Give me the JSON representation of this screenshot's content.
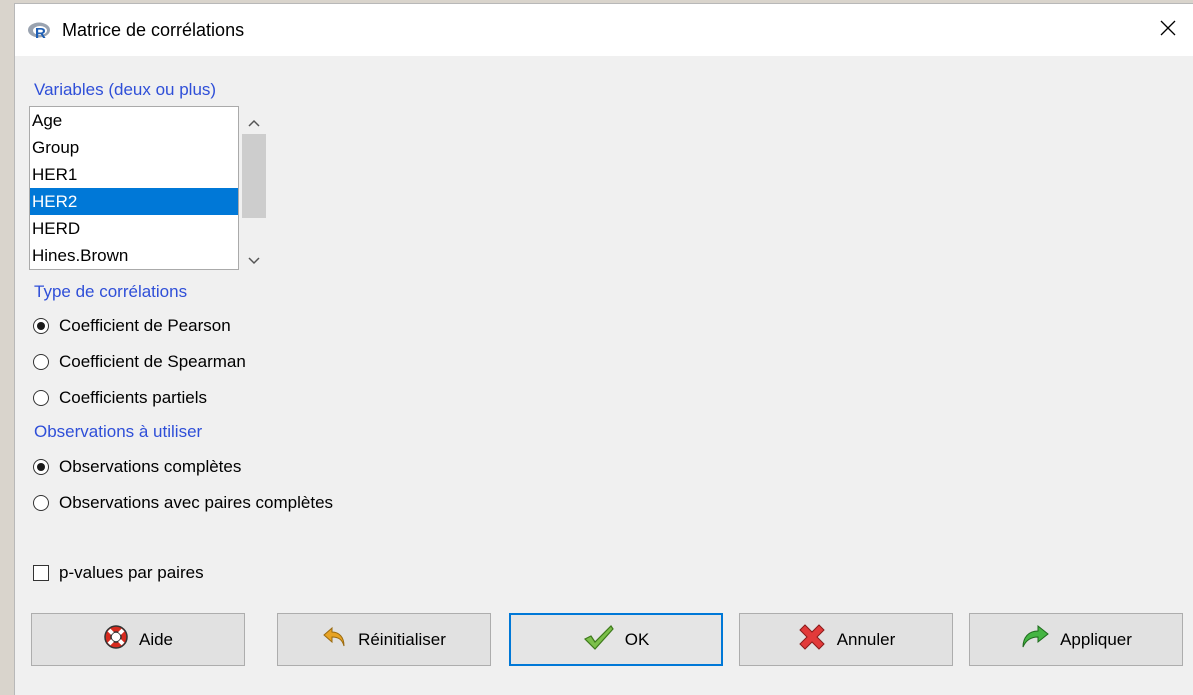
{
  "window": {
    "title": "Matrice de corrélations",
    "app_icon": "r-logo-icon",
    "close_icon": "close-icon"
  },
  "variables": {
    "label": "Variables (deux ou plus)",
    "items": [
      "Age",
      "Group",
      "HER1",
      "HER2",
      "HERD",
      "Hines.Brown"
    ],
    "selected": "HER2"
  },
  "correlation_type": {
    "label": "Type de corrélations",
    "options": [
      "Coefficient de Pearson",
      "Coefficient de Spearman",
      "Coefficients partiels"
    ],
    "selected": "Coefficient de Pearson"
  },
  "observations": {
    "label": "Observations à utiliser",
    "options": [
      "Observations complètes",
      "Observations avec paires complètes"
    ],
    "selected": "Observations complètes"
  },
  "pvalues": {
    "label": "p-values par paires",
    "checked": false
  },
  "buttons": {
    "help": "Aide",
    "reset": "Réinitialiser",
    "ok": "OK",
    "cancel": "Annuler",
    "apply": "Appliquer"
  },
  "colors": {
    "section_label": "#2f4fd8",
    "selection": "#0078d7"
  }
}
